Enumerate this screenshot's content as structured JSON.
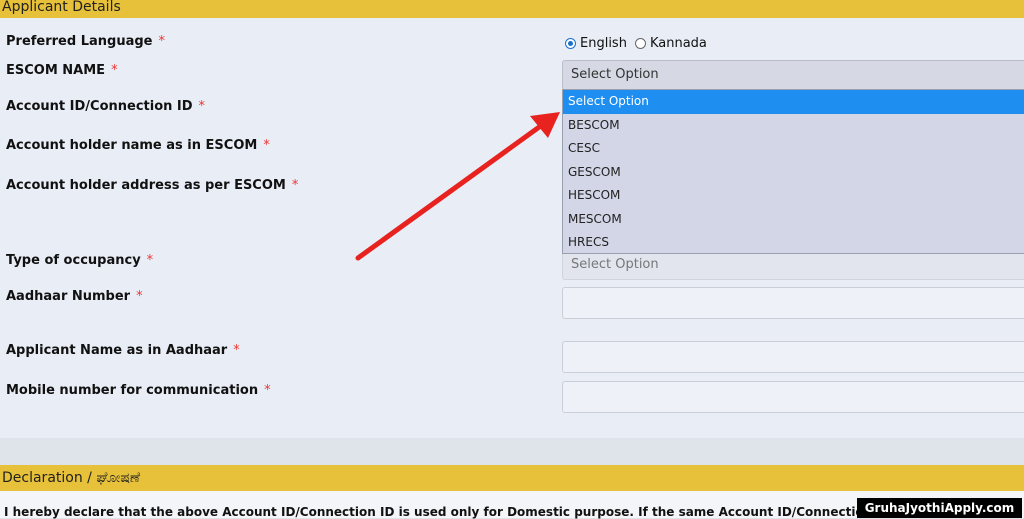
{
  "headers": {
    "applicant_details": "Applicant Details",
    "declaration": "Declaration / ಘೋಷಣೆ"
  },
  "fields": {
    "preferred_language": "Preferred Language",
    "escom_name": "ESCOM NAME",
    "account_id": "Account ID/Connection ID",
    "holder_name": "Account holder name as in ESCOM",
    "holder_address": "Account holder address as per ESCOM",
    "occupancy": "Type of occupancy",
    "aadhaar_number": "Aadhaar Number",
    "applicant_name": "Applicant Name as in Aadhaar",
    "mobile_number": "Mobile number for communication"
  },
  "required_mark": "*",
  "language": {
    "options": [
      "English",
      "Kannada"
    ],
    "selected": "English"
  },
  "escom_select": {
    "value": "Select Option",
    "options": [
      "Select Option",
      "BESCOM",
      "CESC",
      "GESCOM",
      "HESCOM",
      "MESCOM",
      "HRECS"
    ],
    "highlighted": "Select Option"
  },
  "occupancy_select": {
    "value": "Select Option"
  },
  "declaration_text": "I hereby declare that the above Account ID/Connection ID is used only for Domestic purpose. If the same Account ID/Connection",
  "watermark": "GruhaJyothiApply.com",
  "colors": {
    "header": "#e8c13a",
    "highlight": "#1e8ff0",
    "arrow": "#e8231f",
    "required": "#e33"
  }
}
